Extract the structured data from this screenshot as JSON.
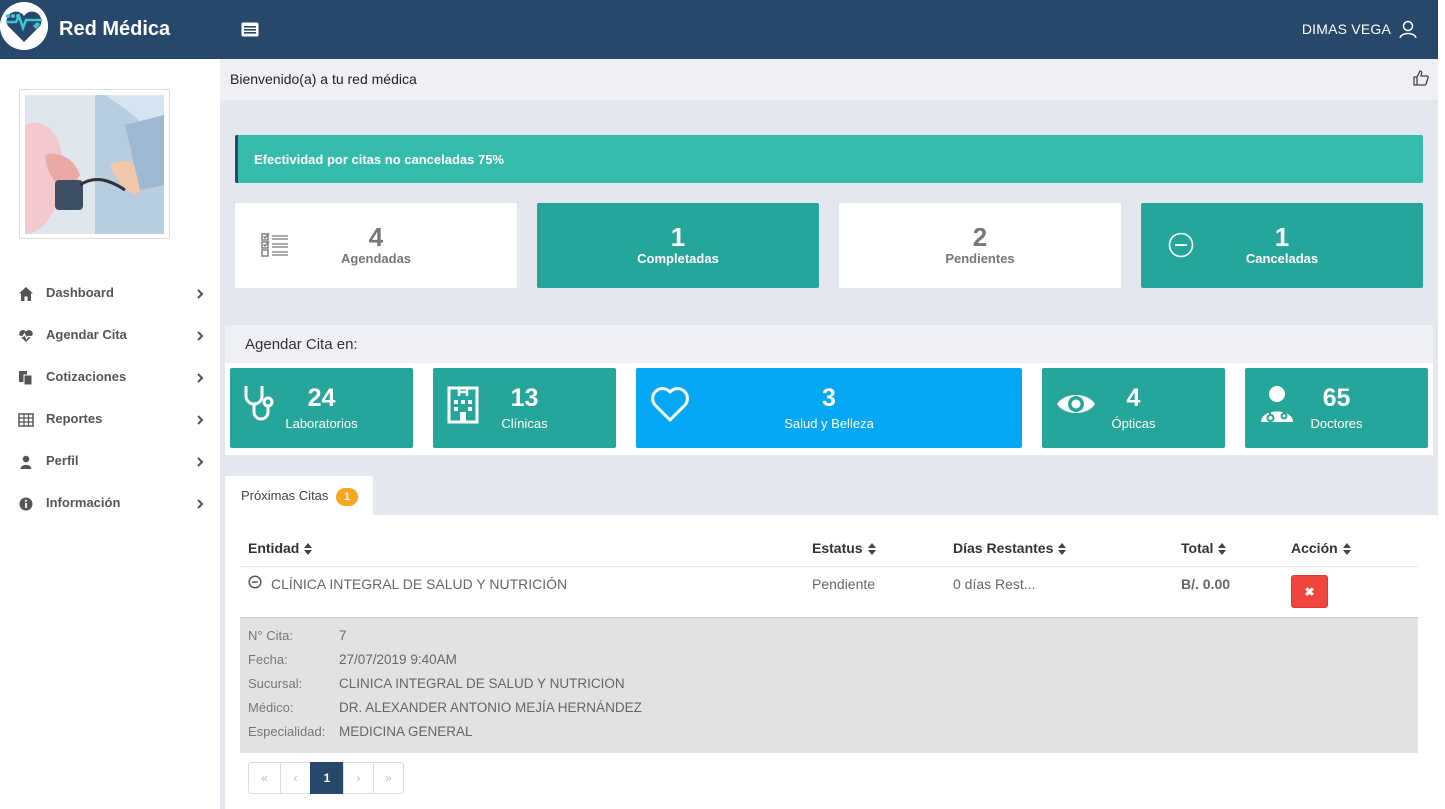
{
  "header": {
    "brand": "Red Médica",
    "user_name": "DIMAS VEGA"
  },
  "sidebar": {
    "items": [
      {
        "label": "Dashboard",
        "icon": "home-icon"
      },
      {
        "label": "Agendar Cita",
        "icon": "heartbeat-icon"
      },
      {
        "label": "Cotizaciones",
        "icon": "copy-icon"
      },
      {
        "label": "Reportes",
        "icon": "table-icon"
      },
      {
        "label": "Perfil",
        "icon": "user-icon"
      },
      {
        "label": "Información",
        "icon": "info-icon"
      }
    ]
  },
  "welcome": {
    "text": "Bienvenido(a) a tu red médica"
  },
  "alert": {
    "text": "Efectividad por citas no canceladas 75%"
  },
  "stats": [
    {
      "value": "4",
      "label": "Agendadas"
    },
    {
      "value": "1",
      "label": "Completadas"
    },
    {
      "value": "2",
      "label": "Pendientes"
    },
    {
      "value": "1",
      "label": "Canceladas"
    }
  ],
  "schedule": {
    "heading": "Agendar Cita en:",
    "categories": [
      {
        "value": "24",
        "label": "Laboratorios",
        "icon": "stethoscope-icon"
      },
      {
        "value": "13",
        "label": "Clínicas",
        "icon": "hospital-icon"
      },
      {
        "value": "3",
        "label": "Salud y Belleza",
        "icon": "heart-icon"
      },
      {
        "value": "4",
        "label": "Ópticas",
        "icon": "eye-icon"
      },
      {
        "value": "65",
        "label": "Doctores",
        "icon": "doctor-icon"
      }
    ]
  },
  "appointments": {
    "tab_label": "Próximas Citas",
    "tab_badge": "1",
    "columns": [
      "Entidad",
      "Estatus",
      "Días Restantes",
      "Total",
      "Acción"
    ],
    "rows": [
      {
        "entity": "CLÍNICA INTEGRAL DE SALUD Y NUTRICIÓN",
        "status": "Pendiente",
        "days_left": "0 días Rest...",
        "total": "B/. 0.00",
        "action": "✖"
      }
    ],
    "detail": [
      {
        "key": "N° Cita:",
        "value": "7"
      },
      {
        "key": "Fecha:",
        "value": "27/07/2019 9:40AM"
      },
      {
        "key": "Sucursal:",
        "value": "CLINICA INTEGRAL DE SALUD Y NUTRICION"
      },
      {
        "key": "Médico:",
        "value": "DR. ALEXANDER ANTONIO MEJÍA HERNÁNDEZ"
      },
      {
        "key": "Especialidad:",
        "value": "MEDICINA GENERAL"
      }
    ],
    "pagination": {
      "first": "«",
      "prev": "‹",
      "current": "1",
      "next": "›",
      "last": "»"
    }
  },
  "colors": {
    "header": "#27476b",
    "teal": "#26a69a",
    "alert": "#35bbab",
    "blue": "#07a8f3",
    "badge": "#f5a623",
    "danger": "#f0443e"
  }
}
